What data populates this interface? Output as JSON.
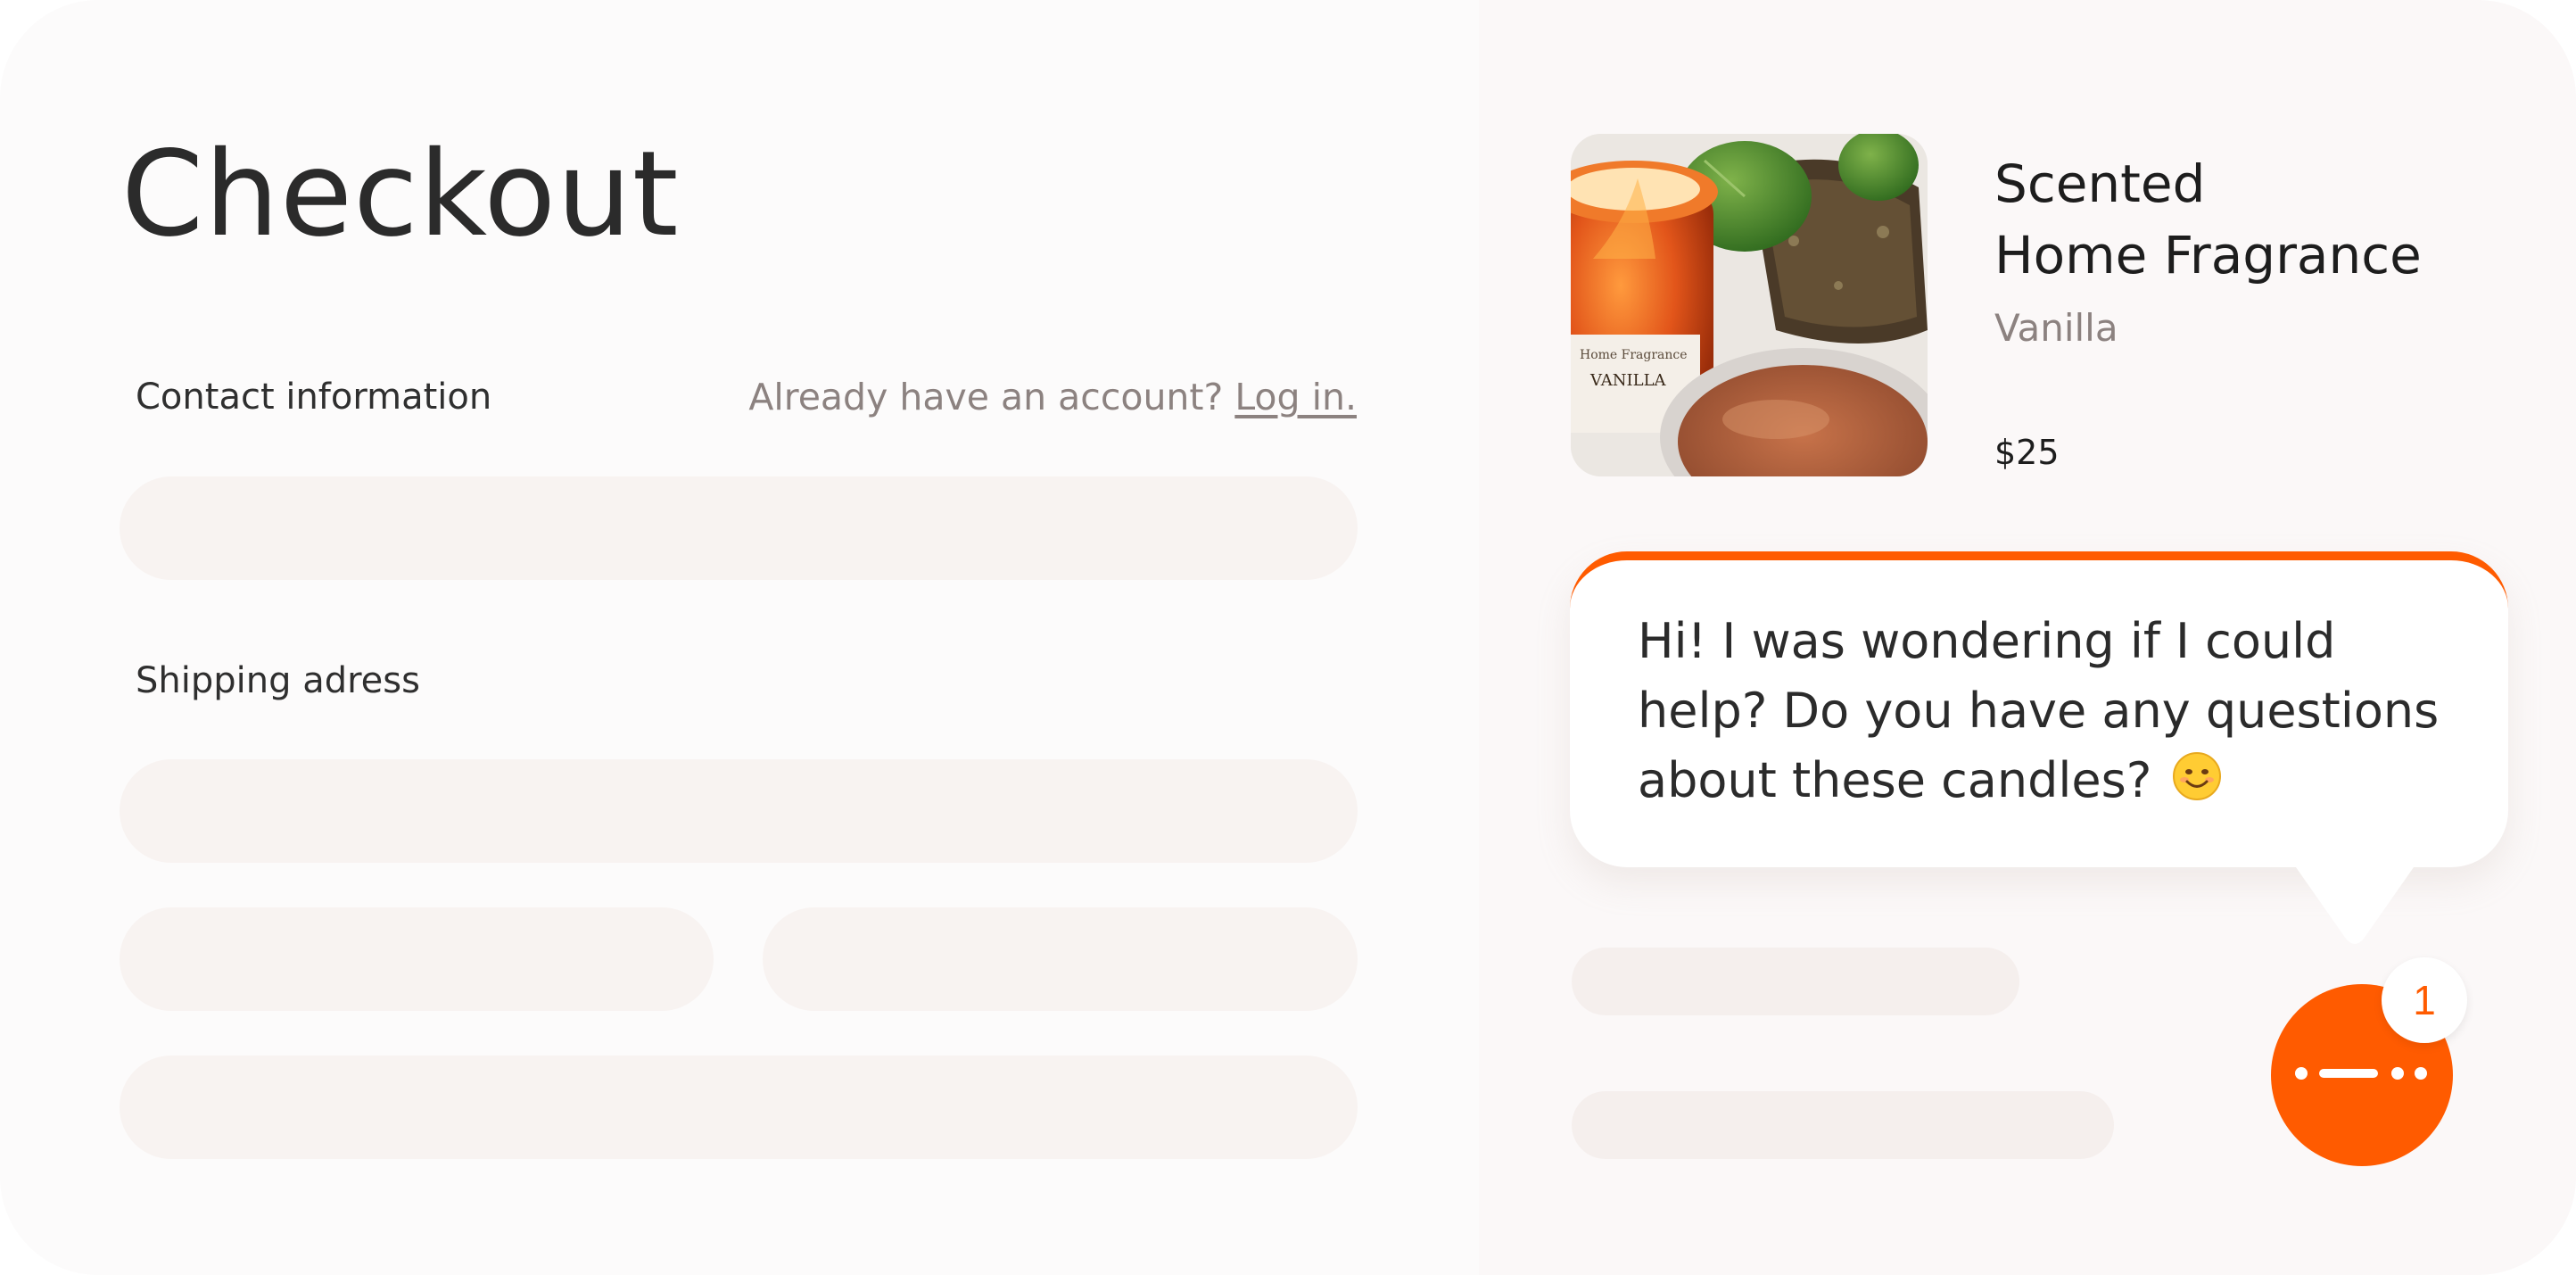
{
  "checkout": {
    "title": "Checkout",
    "contact_label": "Contact information",
    "account_prompt": "Already have an account?",
    "login_link": "Log in.",
    "shipping_label": "Shipping adress"
  },
  "product": {
    "name": "Scented\nHome Fragrance",
    "variant": "Vanilla",
    "price": "$25",
    "image_icon": "candle-product-photo"
  },
  "chat": {
    "message": "Hi! I was wondering if I could help? Do you have any questions about these candles?",
    "emoji": "smiling-face-icon",
    "unread_count": "1",
    "launcher_icon": "chat-dots-icon"
  },
  "colors": {
    "accent": "#ff5b00",
    "muted_text": "#8c8280",
    "field_bg": "#f8f3f1"
  }
}
